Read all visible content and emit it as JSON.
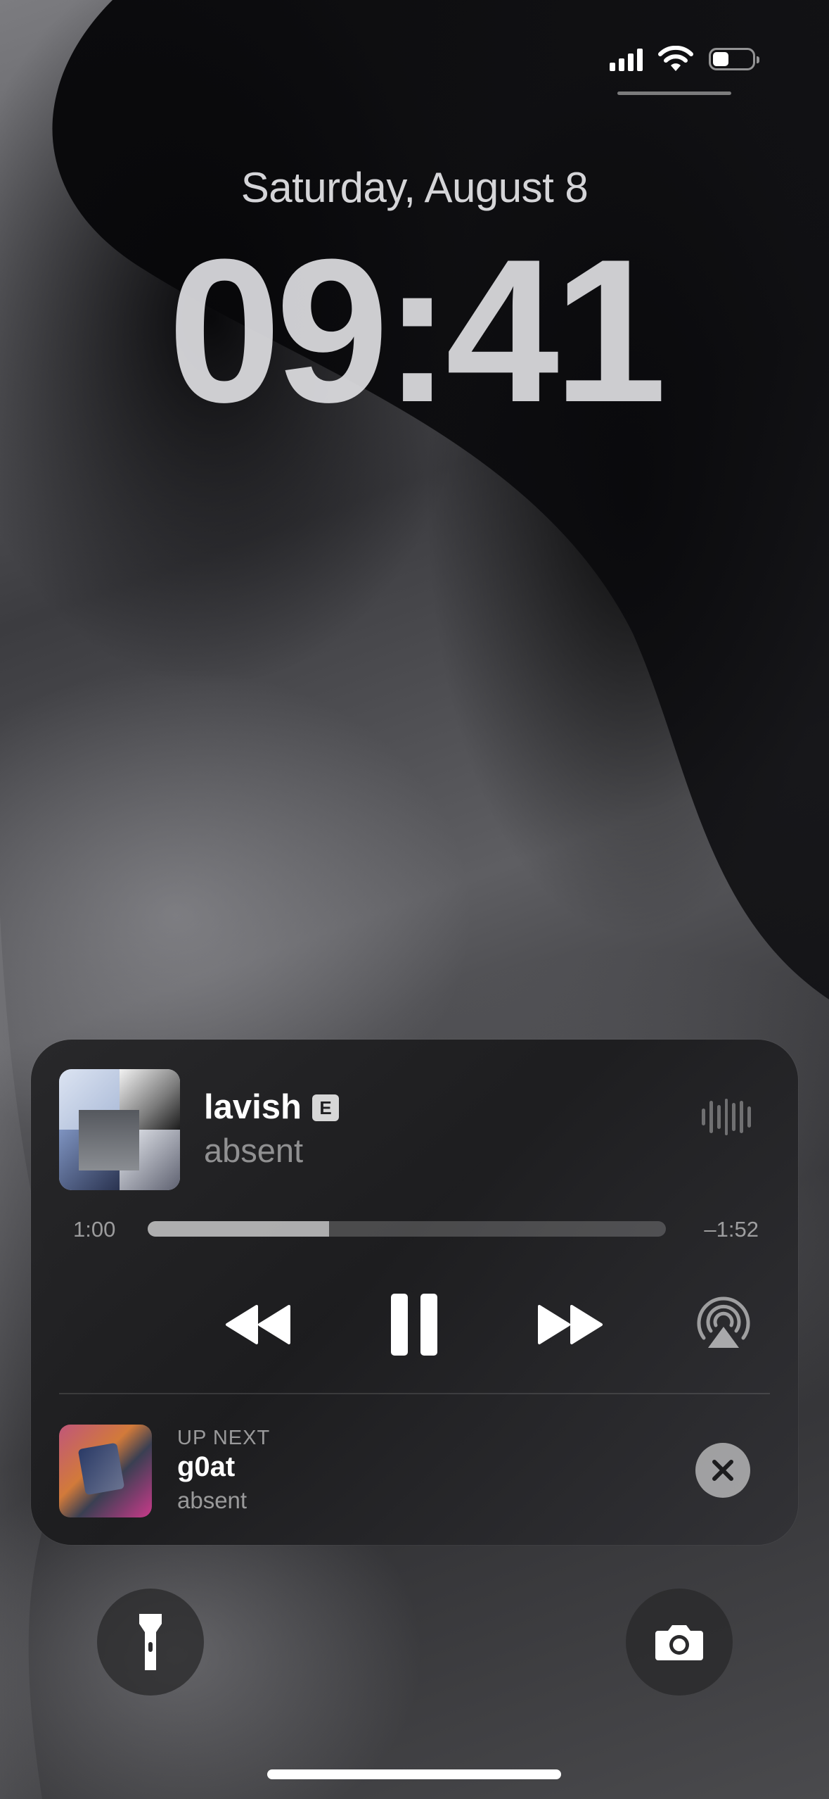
{
  "lock_screen": {
    "date": "Saturday, August 8",
    "time": "09:41"
  },
  "status_bar": {
    "signal_icon": "cellular-signal-icon",
    "wifi_icon": "wifi-icon",
    "battery_icon": "battery-low-icon"
  },
  "now_playing": {
    "title": "lavish",
    "explicit_badge": "E",
    "artist": "absent",
    "elapsed": "1:00",
    "remaining": "–1:52",
    "progress_fraction": 0.35,
    "controls": {
      "rewind_icon": "rewind-icon",
      "pause_icon": "pause-icon",
      "fast_forward_icon": "fast-forward-icon",
      "airplay_icon": "airplay-audio-icon",
      "waveform_icon": "audio-waveform-icon"
    }
  },
  "up_next": {
    "label": "UP NEXT",
    "title": "g0at",
    "artist": "absent"
  },
  "quick_actions": {
    "flashlight_icon": "flashlight-icon",
    "camera_icon": "camera-icon"
  }
}
